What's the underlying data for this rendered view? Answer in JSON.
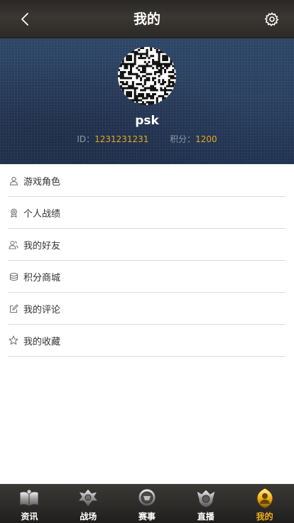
{
  "header": {
    "title": "我的",
    "back_icon": "chevron-left-icon",
    "settings_icon": "gear-icon"
  },
  "profile": {
    "avatar_icon": "qr-avatar-icon",
    "username": "psk",
    "id_label": "ID：",
    "id_value": "1231231231",
    "points_label": "积分：",
    "points_value": "1200"
  },
  "menu": {
    "items": [
      {
        "label": "游戏角色",
        "icon": "user-icon"
      },
      {
        "label": "个人战绩",
        "icon": "medal-icon"
      },
      {
        "label": "我的好友",
        "icon": "friends-icon"
      },
      {
        "label": "积分商城",
        "icon": "coins-icon"
      },
      {
        "label": "我的评论",
        "icon": "edit-icon"
      },
      {
        "label": "我的收藏",
        "icon": "star-icon"
      }
    ]
  },
  "tabbar": {
    "items": [
      {
        "label": "资讯",
        "icon": "book-icon",
        "active": false
      },
      {
        "label": "战场",
        "icon": "battlefield-icon",
        "active": false
      },
      {
        "label": "赛事",
        "icon": "tournament-icon",
        "active": false
      },
      {
        "label": "直播",
        "icon": "live-icon",
        "active": false
      },
      {
        "label": "我的",
        "icon": "profile-emblem-icon",
        "active": true
      }
    ],
    "active_color": "#f2b01e"
  },
  "colors": {
    "accent": "#e9a521",
    "header_bg": "#33312e",
    "profile_bg": "#2a4060",
    "divider": "#dcdcdc",
    "menu_text": "#333333"
  }
}
